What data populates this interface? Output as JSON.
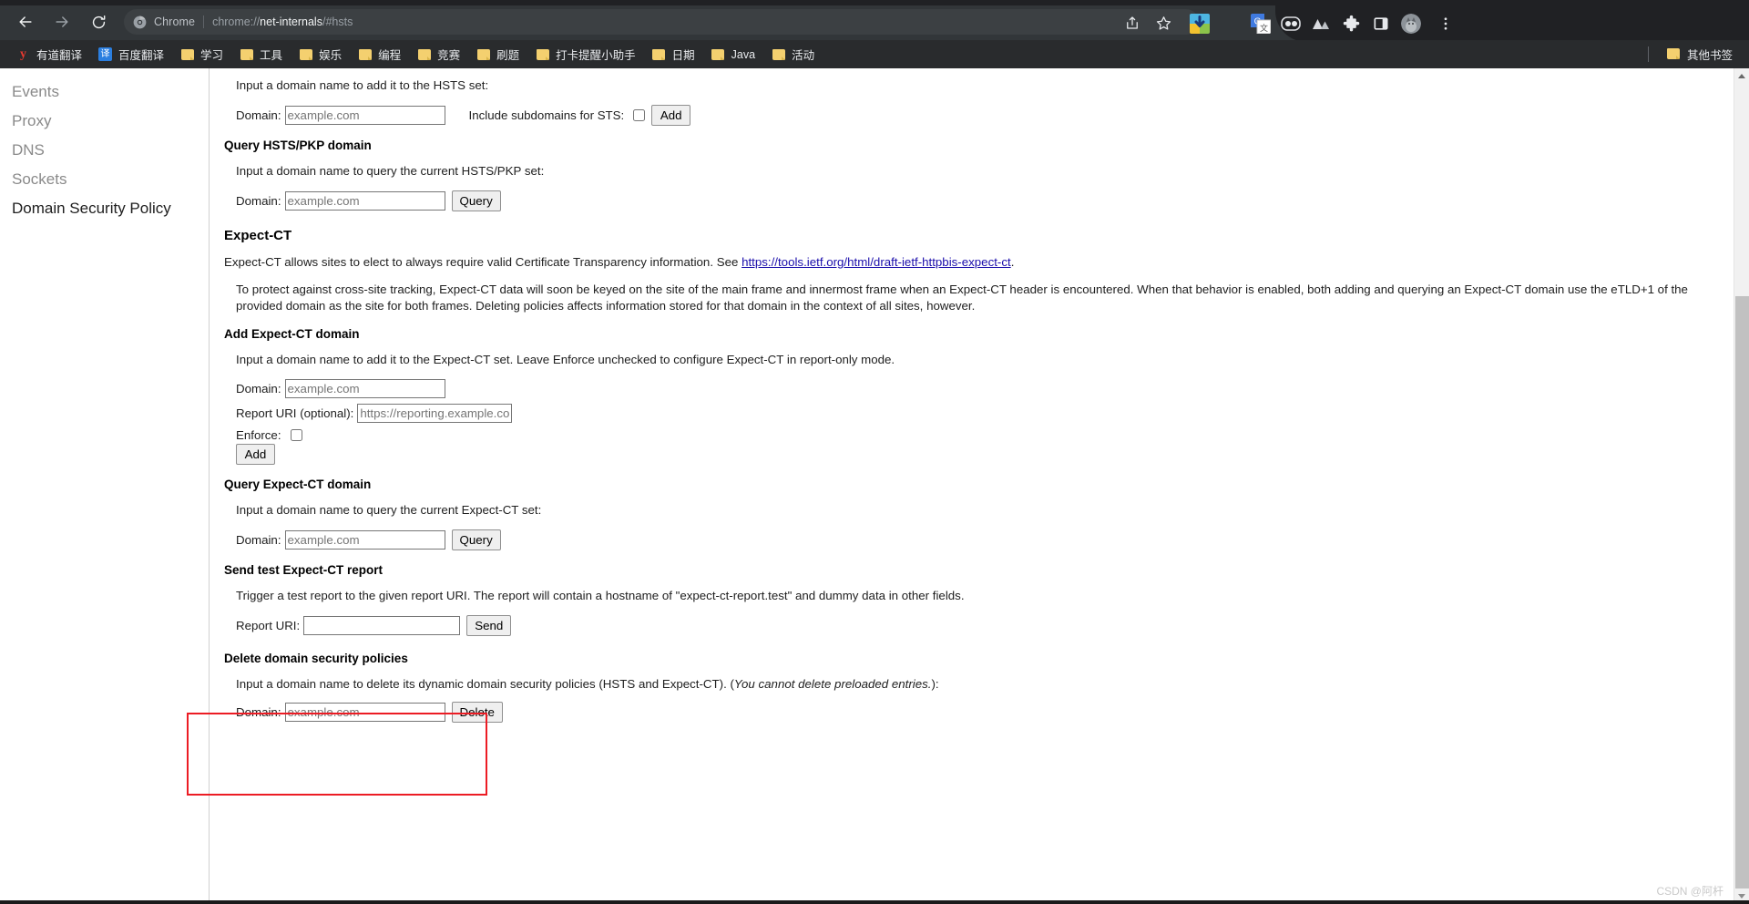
{
  "browser": {
    "nav": {
      "back_icon": "arrow-left-icon",
      "back_glyph": "←",
      "forward_glyph": "→",
      "reload_glyph": "⟳"
    },
    "omnibox": {
      "chip_label": "Chrome",
      "url_prefix": "chrome://",
      "url_host": "net-internals",
      "url_suffix": "/#hsts",
      "full_url": "chrome://net-internals/#hsts",
      "favicon": "chrome-logo-icon"
    },
    "toolbar_icons": [
      {
        "name": "share-icon",
        "glyph": "⤴"
      },
      {
        "name": "bookmark-star-icon",
        "glyph": "☆"
      },
      {
        "name": "download-manager-extension-icon",
        "glyph": "⬇"
      },
      {
        "name": "google-translate-extension-icon",
        "glyph": "G"
      },
      {
        "name": "lastpass-extension-icon",
        "glyph": "oo"
      },
      {
        "name": "mountain-extension-icon",
        "glyph": "▲"
      },
      {
        "name": "extensions-puzzle-icon",
        "glyph": "✦"
      },
      {
        "name": "side-panel-icon",
        "glyph": "▯"
      },
      {
        "name": "profile-avatar-icon",
        "glyph": "🐱"
      },
      {
        "name": "chrome-menu-icon",
        "glyph": "⋮"
      }
    ],
    "bookmarks": [
      {
        "label": "有道翻译",
        "icon": "youdao-favicon"
      },
      {
        "label": "百度翻译",
        "icon": "baidu-fanyi-favicon"
      },
      {
        "label": "学习",
        "icon": "folder-icon"
      },
      {
        "label": "工具",
        "icon": "folder-icon"
      },
      {
        "label": "娱乐",
        "icon": "folder-icon"
      },
      {
        "label": "编程",
        "icon": "folder-icon"
      },
      {
        "label": "竞赛",
        "icon": "folder-icon"
      },
      {
        "label": "刷题",
        "icon": "folder-icon"
      },
      {
        "label": "打卡提醒小助手",
        "icon": "folder-icon"
      },
      {
        "label": "日期",
        "icon": "folder-icon"
      },
      {
        "label": "Java",
        "icon": "folder-icon"
      },
      {
        "label": "活动",
        "icon": "folder-icon"
      }
    ],
    "other_bookmarks": {
      "label": "其他书签",
      "icon": "folder-icon"
    }
  },
  "sidebar": {
    "items": [
      {
        "label": "Events",
        "active": false
      },
      {
        "label": "Proxy",
        "active": false
      },
      {
        "label": "DNS",
        "active": false
      },
      {
        "label": "Sockets",
        "active": false
      },
      {
        "label": "Domain Security Policy",
        "active": true
      }
    ]
  },
  "main": {
    "add_hsts": {
      "description": "Input a domain name to add it to the HSTS set:",
      "domain_label": "Domain:",
      "domain_value": "",
      "domain_placeholder": "example.com",
      "subdomains_label": "Include subdomains for STS:",
      "subdomains_checked": false,
      "add_label": "Add"
    },
    "query_hsts": {
      "heading": "Query HSTS/PKP domain",
      "description": "Input a domain name to query the current HSTS/PKP set:",
      "domain_label": "Domain:",
      "domain_value": "",
      "domain_placeholder": "example.com",
      "query_label": "Query"
    },
    "expect_ct": {
      "heading": "Expect-CT",
      "intro_before_link": "Expect-CT allows sites to elect to always require valid Certificate Transparency information. See ",
      "intro_link": "https://tools.ietf.org/html/draft-ietf-httpbis-expect-ct",
      "intro_after_link": ".",
      "note": "To protect against cross-site tracking, Expect-CT data will soon be keyed on the site of the main frame and innermost frame when an Expect-CT header is encountered. When that behavior is enabled, both adding and querying an Expect-CT domain use the eTLD+1 of the provided domain as the site for both frames. Deleting policies affects information stored for that domain in the context of all sites, however."
    },
    "add_expect_ct": {
      "heading": "Add Expect-CT domain",
      "description": "Input a domain name to add it to the Expect-CT set. Leave Enforce unchecked to configure Expect-CT in report-only mode.",
      "domain_label": "Domain:",
      "domain_value": "",
      "domain_placeholder": "example.com",
      "report_uri_label": "Report URI (optional):",
      "report_uri_value": "",
      "report_uri_placeholder": "https://reporting.example.com",
      "enforce_label": "Enforce:",
      "enforce_checked": false,
      "add_label": "Add"
    },
    "query_expect_ct": {
      "heading": "Query Expect-CT domain",
      "description": "Input a domain name to query the current Expect-CT set:",
      "domain_label": "Domain:",
      "domain_value": "",
      "domain_placeholder": "example.com",
      "query_label": "Query"
    },
    "send_test_report": {
      "heading": "Send test Expect-CT report",
      "description": "Trigger a test report to the given report URI. The report will contain a hostname of \"expect-ct-report.test\" and dummy data in other fields.",
      "report_uri_label": "Report URI:",
      "report_uri_value": "",
      "send_label": "Send"
    },
    "delete_policies": {
      "heading": "Delete domain security policies",
      "description_plain": "Input a domain name to delete its dynamic domain security policies (HSTS and Expect-CT). (",
      "description_italic": "You cannot delete preloaded entries.",
      "description_tail": "):",
      "domain_label": "Domain:",
      "domain_value": "",
      "domain_placeholder": "example.com",
      "delete_label": "Delete",
      "highlight_color": "#ec1c24"
    }
  },
  "scrollbar": {
    "up_arrow": "scroll-up-arrow-icon",
    "down_arrow": "scroll-down-arrow-icon"
  },
  "watermark": {
    "text": "CSDN @阿杆"
  },
  "colors": {
    "chrome_bg": "#323639",
    "bookmarks_bg": "#292b2d",
    "link": "#1a0dab",
    "accent_red": "#ec1c24",
    "sidebar_inactive": "#8a8a8a",
    "sidebar_active": "#202020"
  }
}
